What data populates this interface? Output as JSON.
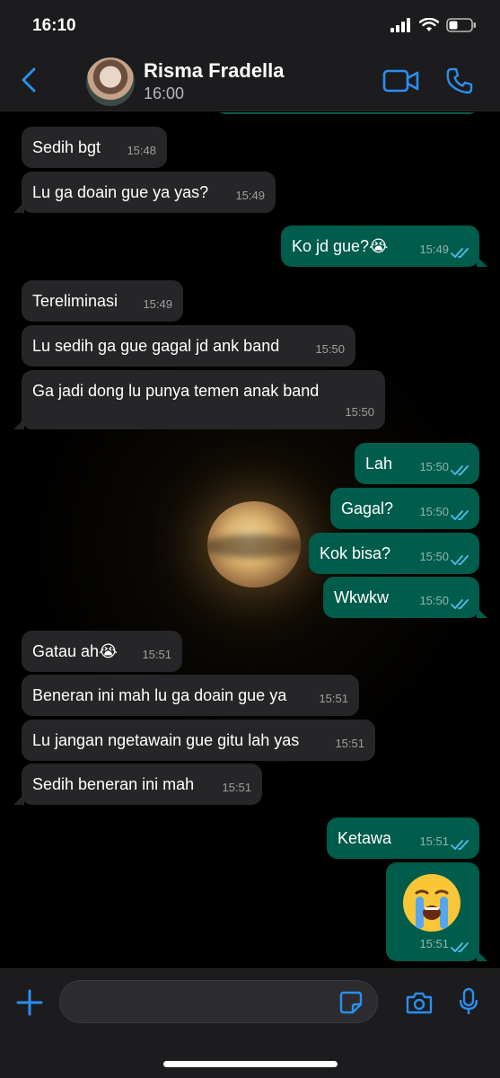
{
  "status_bar": {
    "time": "16:10"
  },
  "header": {
    "contact_name": "Risma Fradella",
    "subtitle": "16:00"
  },
  "messages": [
    {
      "dir": "in",
      "text": "Sedih bgt",
      "time": "15:48"
    },
    {
      "dir": "in",
      "text": "Lu ga doain gue ya yas?",
      "time": "15:49"
    },
    {
      "dir": "out",
      "text": "Ko jd gue?😭",
      "time": "15:49"
    },
    {
      "dir": "in",
      "text": "Tereliminasi",
      "time": "15:49"
    },
    {
      "dir": "in",
      "text": "Lu sedih ga gue gagal jd ank band",
      "time": "15:50"
    },
    {
      "dir": "in",
      "text": "Ga jadi dong lu punya temen anak band",
      "time": "15:50"
    },
    {
      "dir": "out",
      "text": "Lah",
      "time": "15:50"
    },
    {
      "dir": "out",
      "text": "Gagal?",
      "time": "15:50"
    },
    {
      "dir": "out",
      "text": "Kok bisa?",
      "time": "15:50"
    },
    {
      "dir": "out",
      "text": "Wkwkw",
      "time": "15:50"
    },
    {
      "dir": "in",
      "text": "Gatau ah😭",
      "time": "15:51"
    },
    {
      "dir": "in",
      "text": "Beneran ini mah lu ga doain gue ya",
      "time": "15:51"
    },
    {
      "dir": "in",
      "text": "Lu jangan ngetawain gue gitu lah yas",
      "time": "15:51"
    },
    {
      "dir": "in",
      "text": "Sedih beneran ini mah",
      "time": "15:51"
    },
    {
      "dir": "out",
      "text": "Ketawa",
      "time": "15:51"
    },
    {
      "dir": "out",
      "text": "😭",
      "time": "15:51"
    }
  ],
  "icons": {
    "back": "chevron-left-icon",
    "video": "video-camera-icon",
    "call": "phone-icon",
    "plus": "plus-icon",
    "sticker": "sticker-icon",
    "camera": "camera-icon",
    "mic": "microphone-icon",
    "read": "double-check-icon"
  },
  "colors": {
    "accent": "#2b8ef0",
    "outgoing_bubble": "#005c4b",
    "incoming_bubble": "#262628",
    "read_ticks": "#53bdeb",
    "bar_background": "#1c1c1e"
  }
}
